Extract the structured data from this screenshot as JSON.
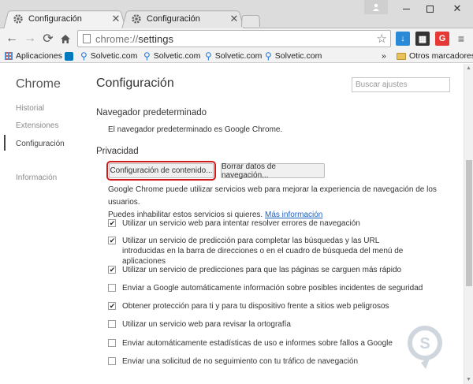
{
  "tabs": [
    {
      "title": "Configuración",
      "icon": "gear-icon"
    },
    {
      "title": "Configuración",
      "icon": "gear-icon"
    }
  ],
  "address": {
    "scheme": "chrome://",
    "path": "settings"
  },
  "bookmarks": {
    "items": [
      "Aplicaciones",
      "Solvetic.com",
      "Solvetic.com",
      "Solvetic.com",
      "Solvetic.com"
    ],
    "more": "»",
    "other": "Otros marcadores"
  },
  "sidebar": {
    "title": "Chrome",
    "items": [
      "Historial",
      "Extensiones",
      "Configuración",
      "Información"
    ]
  },
  "main": {
    "title": "Configuración",
    "search_placeholder": "Buscar ajustes",
    "default_browser": {
      "heading": "Navegador predeterminado",
      "text": "El navegador predeterminado es Google Chrome."
    },
    "privacy": {
      "heading": "Privacidad",
      "content_settings_button": "Configuración de contenido...",
      "clear_data_button": "Borrar datos de navegación...",
      "desc_line1": "Google Chrome puede utilizar servicios web para mejorar la experiencia de navegación de los usuarios.",
      "desc_line2": "Puedes inhabilitar estos servicios si quieres.",
      "more_info": "Más información",
      "options": [
        {
          "label": "Utilizar un servicio web para intentar resolver errores de navegación",
          "checked": true
        },
        {
          "label": "Utilizar un servicio de predicción para completar las búsquedas y las URL introducidas en la barra de direcciones o en el cuadro de búsqueda del menú de aplicaciones",
          "checked": true
        },
        {
          "label": "Utilizar un servicio de predicciones para que las páginas se carguen más rápido",
          "checked": true
        },
        {
          "label": "Enviar a Google automáticamente información sobre posibles incidentes de seguridad",
          "checked": false
        },
        {
          "label": "Obtener protección para ti y para tu dispositivo frente a sitios web peligrosos",
          "checked": true
        },
        {
          "label": "Utilizar un servicio web para revisar la ortografía",
          "checked": false
        },
        {
          "label": "Enviar automáticamente estadísticas de uso e informes sobre fallos a Google",
          "checked": false
        },
        {
          "label": "Enviar una solicitud de no seguimiento con tu tráfico de navegación",
          "checked": false
        }
      ]
    }
  },
  "colors": {
    "highlight": "#d11a1a",
    "link": "#1a5fbf",
    "bookmark_blue": "#2b7bd6"
  }
}
